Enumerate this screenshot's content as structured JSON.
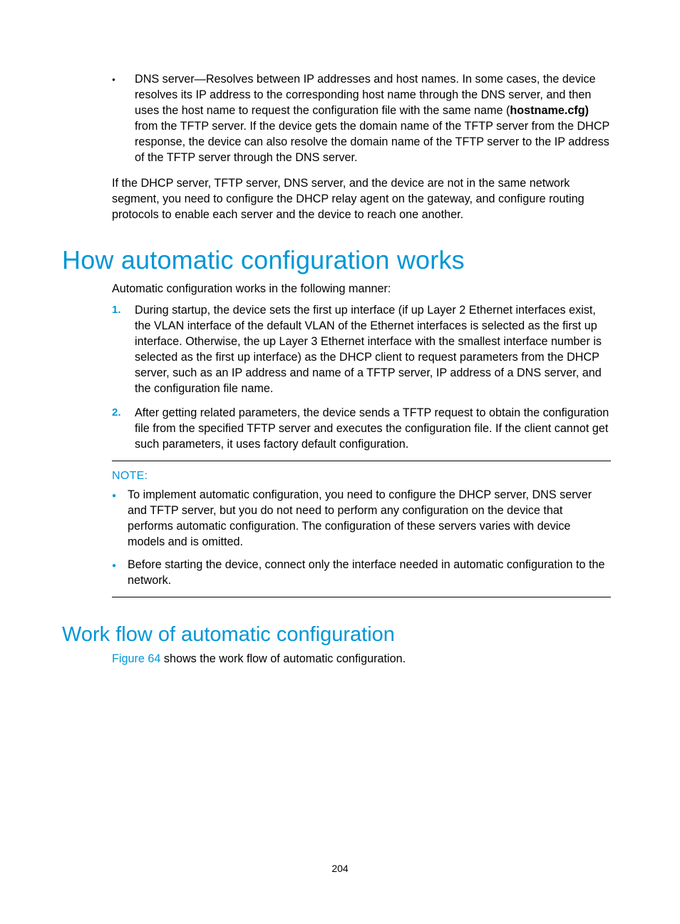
{
  "topBullet": {
    "lead": "DNS server",
    "dash": "—",
    "rest1": "Resolves between IP addresses and host names. In some cases, the device resolves its IP address to the corresponding host name through the DNS server, and then uses the host name to request the configuration file with the same name (",
    "bold": "hostname.cfg)",
    "rest2": " from the TFTP server. If the device gets the domain name of the TFTP server from the DHCP response, the device can also resolve the domain name of the TFTP server to the IP address of the TFTP server through the DNS server."
  },
  "para1": "If the DHCP server, TFTP server, DNS server, and the device are not in the same network segment, you need to configure the DHCP relay agent on the gateway, and configure routing protocols to enable each server and the device to reach one another.",
  "h1": "How automatic configuration works",
  "intro": "Automatic configuration works in the following manner:",
  "steps": [
    "During startup, the device sets the first up interface (if up Layer 2 Ethernet interfaces exist, the VLAN interface of the default VLAN of the Ethernet interfaces is selected as the first up interface. Otherwise, the up Layer 3 Ethernet interface with the smallest interface number is selected as the first up interface) as the DHCP client to request parameters from the DHCP server, such as an IP address and name of a TFTP server, IP address of a DNS server, and the configuration file name.",
    "After getting related parameters, the device sends a TFTP request to obtain the configuration file from the specified TFTP server and executes the configuration file. If the client cannot get such parameters, it uses factory default configuration."
  ],
  "noteLabel": "NOTE:",
  "notes": [
    "To implement automatic configuration, you need to configure the DHCP server, DNS server and TFTP server, but you do not need to perform any configuration on the device that performs automatic configuration. The configuration of these servers varies with device models and is omitted.",
    "Before starting the device, connect only the interface needed in automatic configuration to the network."
  ],
  "h2": "Work flow of automatic configuration",
  "figureRef": "Figure 64",
  "figureTail": " shows the work flow of automatic configuration.",
  "pageNumber": "204"
}
